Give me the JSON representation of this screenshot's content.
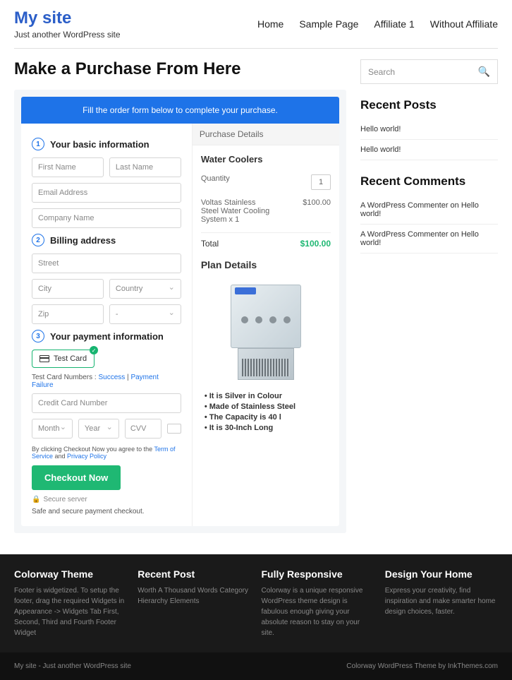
{
  "header": {
    "site_title": "My site",
    "tagline": "Just another WordPress site"
  },
  "nav": [
    "Home",
    "Sample Page",
    "Affiliate 1",
    "Without Affiliate"
  ],
  "page_title": "Make a Purchase From Here",
  "banner": "Fill the order form below to complete your purchase.",
  "sections": {
    "s1": "Your basic information",
    "s2": "Billing address",
    "s3": "Your payment information"
  },
  "ph": {
    "first": "First Name",
    "last": "Last Name",
    "email": "Email Address",
    "company": "Company Name",
    "street": "Street",
    "city": "City",
    "country": "Country",
    "zip": "Zip",
    "dash": "-",
    "cc": "Credit Card Number",
    "month": "Month",
    "year": "Year",
    "cvv": "CVV"
  },
  "test_card": {
    "label": "Test Card",
    "note_pre": "Test Card Numbers : ",
    "success": "Success",
    "pf": "Payment Failure"
  },
  "terms": {
    "pre": "By clicking Checkout Now you agree to the ",
    "tos": "Term of Service",
    "and": " and ",
    "pp": "Privacy Policy"
  },
  "checkout_btn": "Checkout Now",
  "secure": "Secure server",
  "safe": "Safe and secure payment checkout.",
  "purchase": {
    "head": "Purchase Details",
    "product": "Water Coolers",
    "qty_label": "Quantity",
    "qty": "1",
    "item": "Voltas Stainless Steel Water Cooling System x 1",
    "price": "$100.00",
    "total_label": "Total",
    "total": "$100.00"
  },
  "plan": {
    "title": "Plan Details",
    "features": [
      "It is Silver in Colour",
      "Made of Stainless Steel",
      "The Capacity is 40 l",
      "It is 30-Inch Long"
    ]
  },
  "sidebar": {
    "search": "Search",
    "recent_posts": {
      "title": "Recent Posts",
      "items": [
        "Hello world!",
        "Hello world!"
      ]
    },
    "recent_comments": {
      "title": "Recent Comments",
      "items": [
        "A WordPress Commenter on Hello world!",
        "A WordPress Commenter on Hello world!"
      ]
    }
  },
  "footer": {
    "cols": [
      {
        "title": "Colorway Theme",
        "text": "Footer is widgetized. To setup the footer, drag the required Widgets in Appearance -> Widgets Tab First, Second, Third and Fourth Footer Widget"
      },
      {
        "title": "Recent Post",
        "text": "Worth A Thousand Words Category Hierarchy Elements"
      },
      {
        "title": "Fully Responsive",
        "text": "Colorway is a unique responsive WordPress theme design is fabulous enough giving your absolute reason to stay on your site."
      },
      {
        "title": "Design Your Home",
        "text": "Express your creativity, find inspiration and make smarter home design choices, faster."
      }
    ],
    "bar_left": "My site - Just another WordPress site",
    "bar_right": "Colorway WordPress Theme by InkThemes.com"
  }
}
